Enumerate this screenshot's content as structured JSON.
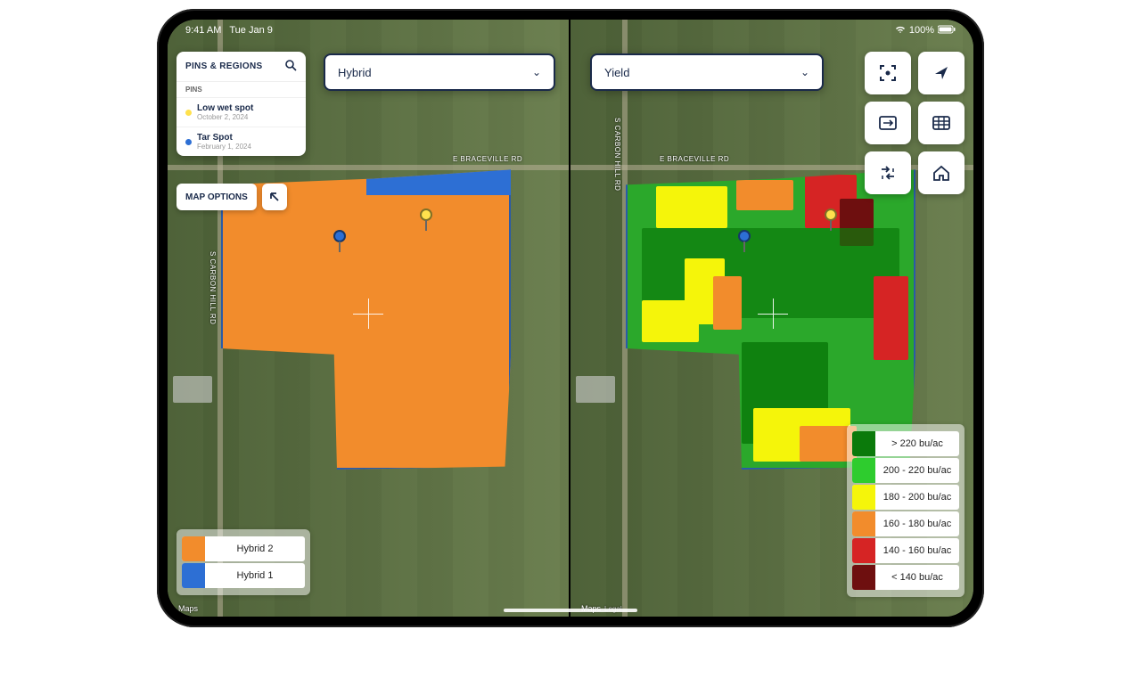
{
  "status": {
    "time": "9:41 AM",
    "date": "Tue Jan 9",
    "battery": "100%"
  },
  "sidebar": {
    "title": "PINS & REGIONS",
    "section": "PINS",
    "items": [
      {
        "name": "Low wet spot",
        "date": "October 2, 2024",
        "color": "#ffe14d"
      },
      {
        "name": "Tar Spot",
        "date": "February 1, 2024",
        "color": "#2d6fd4"
      }
    ],
    "map_options": "MAP OPTIONS"
  },
  "dropdowns": {
    "left": "Hybrid",
    "right": "Yield"
  },
  "field": {
    "road_label_h": "E BRACEVILLE RD",
    "road_label_v": "S CARBON HILL RD"
  },
  "legend_left": [
    {
      "color": "#f28c2c",
      "label": "Hybrid 2"
    },
    {
      "color": "#2d6fd4",
      "label": "Hybrid 1"
    }
  ],
  "legend_right": [
    {
      "color": "#0b7a0b",
      "label": "> 220 bu/ac"
    },
    {
      "color": "#2ecc2e",
      "label": "200 - 220 bu/ac"
    },
    {
      "color": "#f5f50a",
      "label": "180 - 200 bu/ac"
    },
    {
      "color": "#f28c2c",
      "label": "160 - 180 bu/ac"
    },
    {
      "color": "#d62424",
      "label": "140 - 160 bu/ac"
    },
    {
      "color": "#6e0f0f",
      "label": "< 140 bu/ac"
    }
  ],
  "attribution": {
    "brand": "Maps",
    "sub": "Legal"
  }
}
